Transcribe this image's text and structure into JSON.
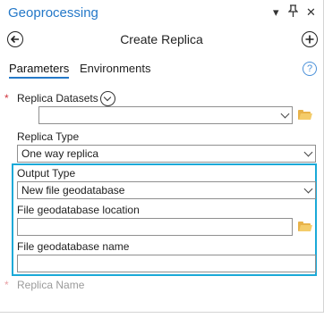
{
  "pane": {
    "title": "Geoprocessing",
    "pin_glyph": "▾",
    "pin_icon": "pin-icon",
    "close_glyph": "✕"
  },
  "tool": {
    "title": "Create Replica"
  },
  "tabs": [
    {
      "label": "Parameters",
      "active": true
    },
    {
      "label": "Environments",
      "active": false
    }
  ],
  "help_glyph": "?",
  "params": {
    "replica_datasets": {
      "label": "Replica Datasets",
      "required": true,
      "value": ""
    },
    "replica_type": {
      "label": "Replica Type",
      "value": "One way replica"
    },
    "output_type": {
      "label": "Output Type",
      "value": "New file geodatabase"
    },
    "fgdb_location": {
      "label": "File geodatabase location",
      "value": ""
    },
    "fgdb_name": {
      "label": "File geodatabase name",
      "value": ""
    },
    "replica_name": {
      "label": "Replica Name",
      "required": true
    }
  },
  "required_mark": "*",
  "colors": {
    "title": "#2478c8",
    "highlight": "#1aa9d8",
    "required": "#d0343d",
    "folder": "#e8b34a"
  }
}
